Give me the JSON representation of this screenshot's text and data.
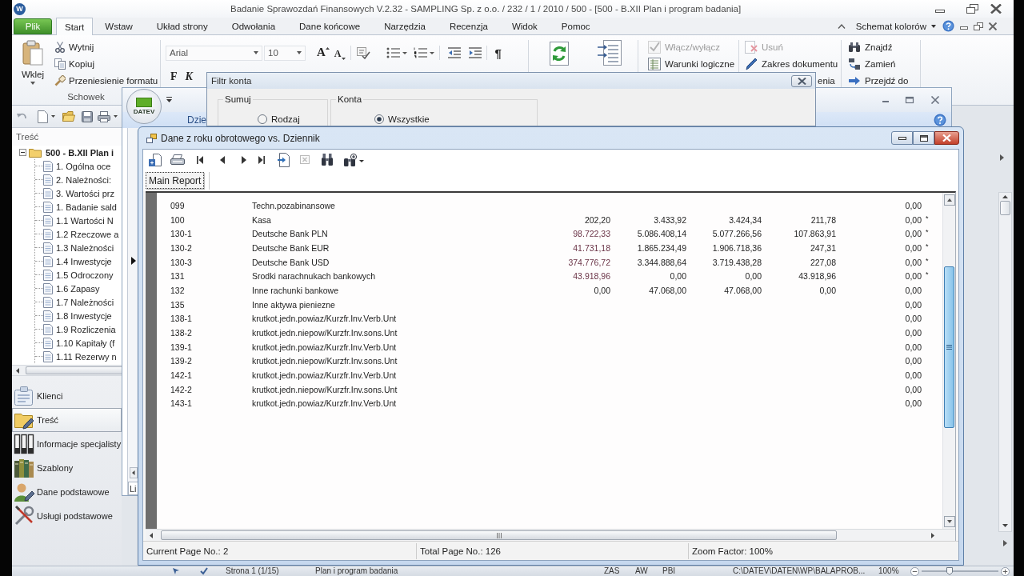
{
  "window": {
    "logo": "W",
    "title": "Badanie Sprawozdań Finansowych V.2.32 - SAMPLING Sp. z o.o. / 232 / 1 / 2010 / 500  - [500 - B.XII Plan i program badania]"
  },
  "ribbon": {
    "file_tab": "Plik",
    "tabs": [
      {
        "label": "Start",
        "selected": true
      },
      {
        "label": "Wstaw",
        "selected": false
      },
      {
        "label": "Układ strony",
        "selected": false
      },
      {
        "label": "Odwołania",
        "selected": false
      },
      {
        "label": "Dane końcowe",
        "selected": false
      },
      {
        "label": "Narzędzia",
        "selected": false
      },
      {
        "label": "Recenzja",
        "selected": false
      },
      {
        "label": "Widok",
        "selected": false
      },
      {
        "label": "Pomoc",
        "selected": false
      }
    ],
    "color_scheme": "Schemat kolorów",
    "clipboard": {
      "paste": "Wklej",
      "items": [
        {
          "kind": "cut",
          "label": "Wytnij"
        },
        {
          "kind": "copy",
          "label": "Kopiuj"
        },
        {
          "kind": "format",
          "label": "Przeniesienie formatu"
        }
      ],
      "group_label": "Schowek"
    },
    "font": {
      "family": "Arial",
      "size": "10",
      "grow": "A",
      "shrink": "A",
      "bold": "F",
      "italic": "K"
    },
    "paragraph_mark": "¶",
    "commands": [
      {
        "kind": "toggle",
        "label": "Włącz/wyłącz",
        "disabled": true
      },
      {
        "kind": "conditions",
        "label": "Warunki logiczne",
        "disabled": false
      }
    ],
    "document": [
      {
        "kind": "delete",
        "label": "Usuń",
        "disabled": true
      },
      {
        "kind": "range",
        "label": "Zakres dokumentu",
        "disabled": false
      },
      {
        "kind": "partial",
        "label": "enia",
        "disabled": false
      }
    ],
    "editing": [
      {
        "kind": "find",
        "label": "Znajdź"
      },
      {
        "kind": "replace",
        "label": "Zamień"
      },
      {
        "kind": "goto",
        "label": "Przejdź do"
      }
    ]
  },
  "sidebar": {
    "title": "Treść",
    "tree": {
      "label": "500 - B.XII Plan i",
      "expanded": true,
      "children": [
        {
          "label": "1. Ogólna oce"
        },
        {
          "label": "2. Należności:"
        },
        {
          "label": "3. Wartości prz"
        },
        {
          "label": "1. Badanie sald"
        },
        {
          "label": "1.1 Wartości N"
        },
        {
          "label": "1.2 Rzeczowe a"
        },
        {
          "label": "1.3 Należności"
        },
        {
          "label": "1.4 Inwestycje"
        },
        {
          "label": "1.5 Odroczony"
        },
        {
          "label": "1.6 Zapasy"
        },
        {
          "label": "1.7 Należności"
        },
        {
          "label": "1.8 Inwestycje"
        },
        {
          "label": "1.9 Rozliczenia"
        },
        {
          "label": "1.10 Kapitały (f"
        },
        {
          "label": "1.11 Rezerwy n"
        }
      ]
    },
    "nav": [
      {
        "kind": "clients",
        "label": "Klienci",
        "selected": false
      },
      {
        "kind": "content",
        "label": "Treść",
        "selected": true
      },
      {
        "kind": "info",
        "label": "Informacje specjalisty",
        "selected": false
      },
      {
        "kind": "templates",
        "label": "Szablony",
        "selected": false
      },
      {
        "kind": "data",
        "label": "Dane podstawowe",
        "selected": false
      },
      {
        "kind": "services",
        "label": "Usługi podstawowe",
        "selected": false
      }
    ]
  },
  "datev_window": {
    "logo": "DATEV",
    "ribbon_tab": "Dzie",
    "side_tab": "Li"
  },
  "filter_dialog": {
    "title": "Filtr konta",
    "groups": [
      {
        "title": "Sumuj",
        "option": {
          "label": "Rodzaj",
          "selected": false
        }
      },
      {
        "title": "Konta",
        "option": {
          "label": "Wszystkie",
          "selected": true
        }
      }
    ]
  },
  "report_window": {
    "title": "Dane z roku obrotowego vs. Dziennik",
    "toolbar": [
      {
        "kind": "export",
        "disabled": false
      },
      {
        "kind": "print",
        "disabled": false
      },
      {
        "kind": "first",
        "disabled": false
      },
      {
        "kind": "previous",
        "disabled": false
      },
      {
        "kind": "next",
        "disabled": false
      },
      {
        "kind": "last",
        "disabled": false
      },
      {
        "kind": "goto",
        "disabled": false
      },
      {
        "kind": "stop",
        "disabled": true
      },
      {
        "kind": "search",
        "disabled": false
      },
      {
        "kind": "zoom",
        "disabled": false
      }
    ],
    "tabs": [
      {
        "label": "Main Report",
        "selected": true
      }
    ],
    "rows": [
      {
        "account": "099",
        "name": "Techn.pozabinansowe",
        "column_7": "0,00"
      },
      {
        "account": "100",
        "name": "Kasa",
        "column_3": "202,20",
        "column_3_highlighted": false,
        "column_4": "3.433,92",
        "column_5": "3.424,34",
        "column_6": "211,78",
        "column_7": "0,00",
        "column_8": "*"
      },
      {
        "account": "130-1",
        "name": "Deutsche Bank PLN",
        "column_3": "98.722,33",
        "column_3_highlighted": true,
        "column_4": "5.086.408,14",
        "column_5": "5.077.266,56",
        "column_6": "107.863,91",
        "column_7": "0,00",
        "column_8": "*"
      },
      {
        "account": "130-2",
        "name": "Deutsche Bank EUR",
        "column_3": "41.731,18",
        "column_3_highlighted": true,
        "column_4": "1.865.234,49",
        "column_5": "1.906.718,36",
        "column_6": "247,31",
        "column_7": "0,00",
        "column_8": "*"
      },
      {
        "account": "130-3",
        "name": "Deutsche Bank USD",
        "column_3": "374.776,72",
        "column_3_highlighted": true,
        "column_4": "3.344.888,64",
        "column_5": "3.719.438,28",
        "column_6": "227,08",
        "column_7": "0,00",
        "column_8": "*"
      },
      {
        "account": "131",
        "name": "Srodki narachnukach bankowych",
        "column_3": "43.918,96",
        "column_3_highlighted": true,
        "column_4": "0,00",
        "column_5": "0,00",
        "column_6": "43.918,96",
        "column_7": "0,00",
        "column_8": "*"
      },
      {
        "account": "132",
        "name": "Inne rachunki bankowe",
        "column_3": "0,00",
        "column_3_highlighted": false,
        "column_4": "47.068,00",
        "column_5": "47.068,00",
        "column_6": "0,00",
        "column_7": "0,00"
      },
      {
        "account": "135",
        "name": "Inne aktywa pieniezne",
        "column_7": "0,00"
      },
      {
        "account": "138-1",
        "name": "krutkot.jedn.powiaz/Kurzfr.Inv.Verb.Unt",
        "column_7": "0,00"
      },
      {
        "account": "138-2",
        "name": "krutkot.jedn.niepow/Kurzfr.Inv.sons.Unt",
        "column_7": "0,00"
      },
      {
        "account": "139-1",
        "name": "krutkot.jedn.powiaz/Kurzfr.Inv.Verb.Unt",
        "column_7": "0,00"
      },
      {
        "account": "139-2",
        "name": "krutkot.jedn.niepow/Kurzfr.Inv.sons.Unt",
        "column_7": "0,00"
      },
      {
        "account": "142-1",
        "name": "krutkot.jedn.powiaz/Kurzfr.Inv.Verb.Unt",
        "column_7": "0,00"
      },
      {
        "account": "142-2",
        "name": "krutkot.jedn.niepow/Kurzfr.Inv.sons.Unt",
        "column_7": "0,00"
      },
      {
        "account": "143-1",
        "name": "krutkot.jedn.powiaz/Kurzfr.Inv.Verb.Unt",
        "column_7": "0,00"
      }
    ],
    "status": [
      "Current Page No.: 2",
      "Total Page No.: 126",
      "Zoom Factor: 100%"
    ]
  },
  "status_bar": {
    "items": [
      "Strona 1 (1/15)",
      "Plan i program badania",
      "ZAS",
      "AW",
      "PBI",
      "C:\\DATEV\\DATEN\\WP\\BALAPROB...",
      "100%"
    ],
    "zoom_slider": {
      "level": 0.35
    }
  }
}
